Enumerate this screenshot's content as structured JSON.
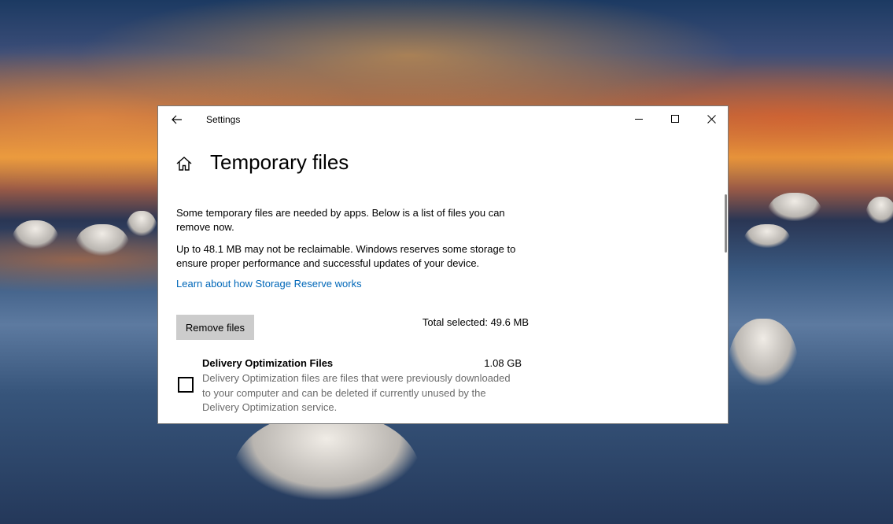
{
  "window": {
    "app_title": "Settings",
    "page_title": "Temporary files",
    "icons": {
      "back": "back-arrow-icon",
      "minimize": "minimize-icon",
      "maximize": "maximize-icon",
      "close": "close-icon",
      "home": "home-icon"
    }
  },
  "content": {
    "intro": "Some temporary files are needed by apps. Below is a list of files you can remove now.",
    "reserve_note": "Up to 48.1 MB may not be reclaimable. Windows reserves some storage to ensure proper performance and successful updates of your device.",
    "learn_link": "Learn about how Storage Reserve works",
    "remove_button": "Remove files",
    "total_selected": "Total selected: 49.6 MB",
    "items": [
      {
        "name": "Delivery Optimization Files",
        "size": "1.08 GB",
        "description": "Delivery Optimization files are files that were previously downloaded to your computer and can be deleted if currently unused by the Delivery Optimization service.",
        "checked": false
      }
    ]
  },
  "colors": {
    "link": "#0067b8",
    "button_bg": "#cccccc",
    "description_text": "#6b6b6b"
  }
}
